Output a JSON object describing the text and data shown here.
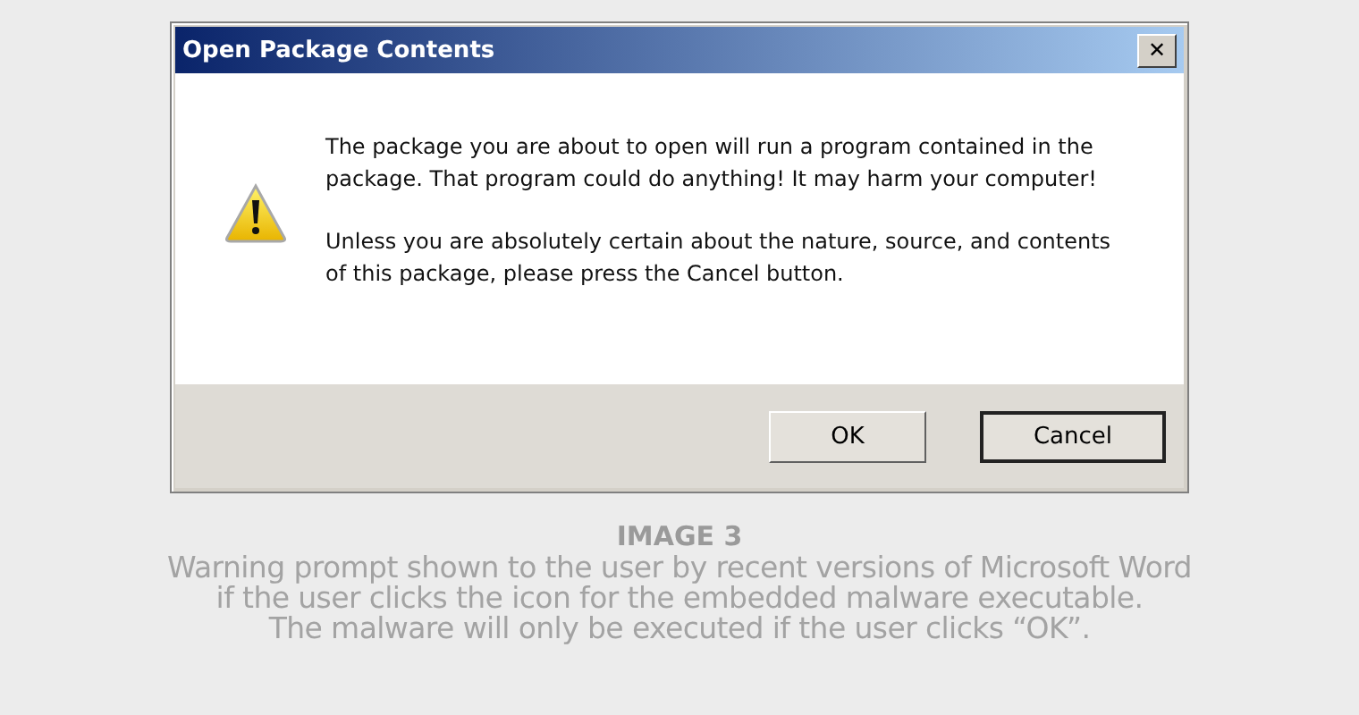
{
  "dialog": {
    "title": "Open Package Contents",
    "close": "✕",
    "paragraphs": [
      "The package you are about to open will run a program contained in the package. That program could do anything!  It may harm your computer!",
      "Unless you are absolutely certain about the nature, source, and contents of this package, please press the Cancel button."
    ],
    "buttons": [
      {
        "label": "OK",
        "default": false
      },
      {
        "label": "Cancel",
        "default": true
      }
    ]
  },
  "caption": {
    "heading": "IMAGE 3",
    "lines": [
      "Warning prompt shown to the user by recent versions of Microsoft Word",
      "if the user clicks the icon for the embedded malware executable.",
      "The malware will only be executed if the user clicks “OK”."
    ]
  }
}
